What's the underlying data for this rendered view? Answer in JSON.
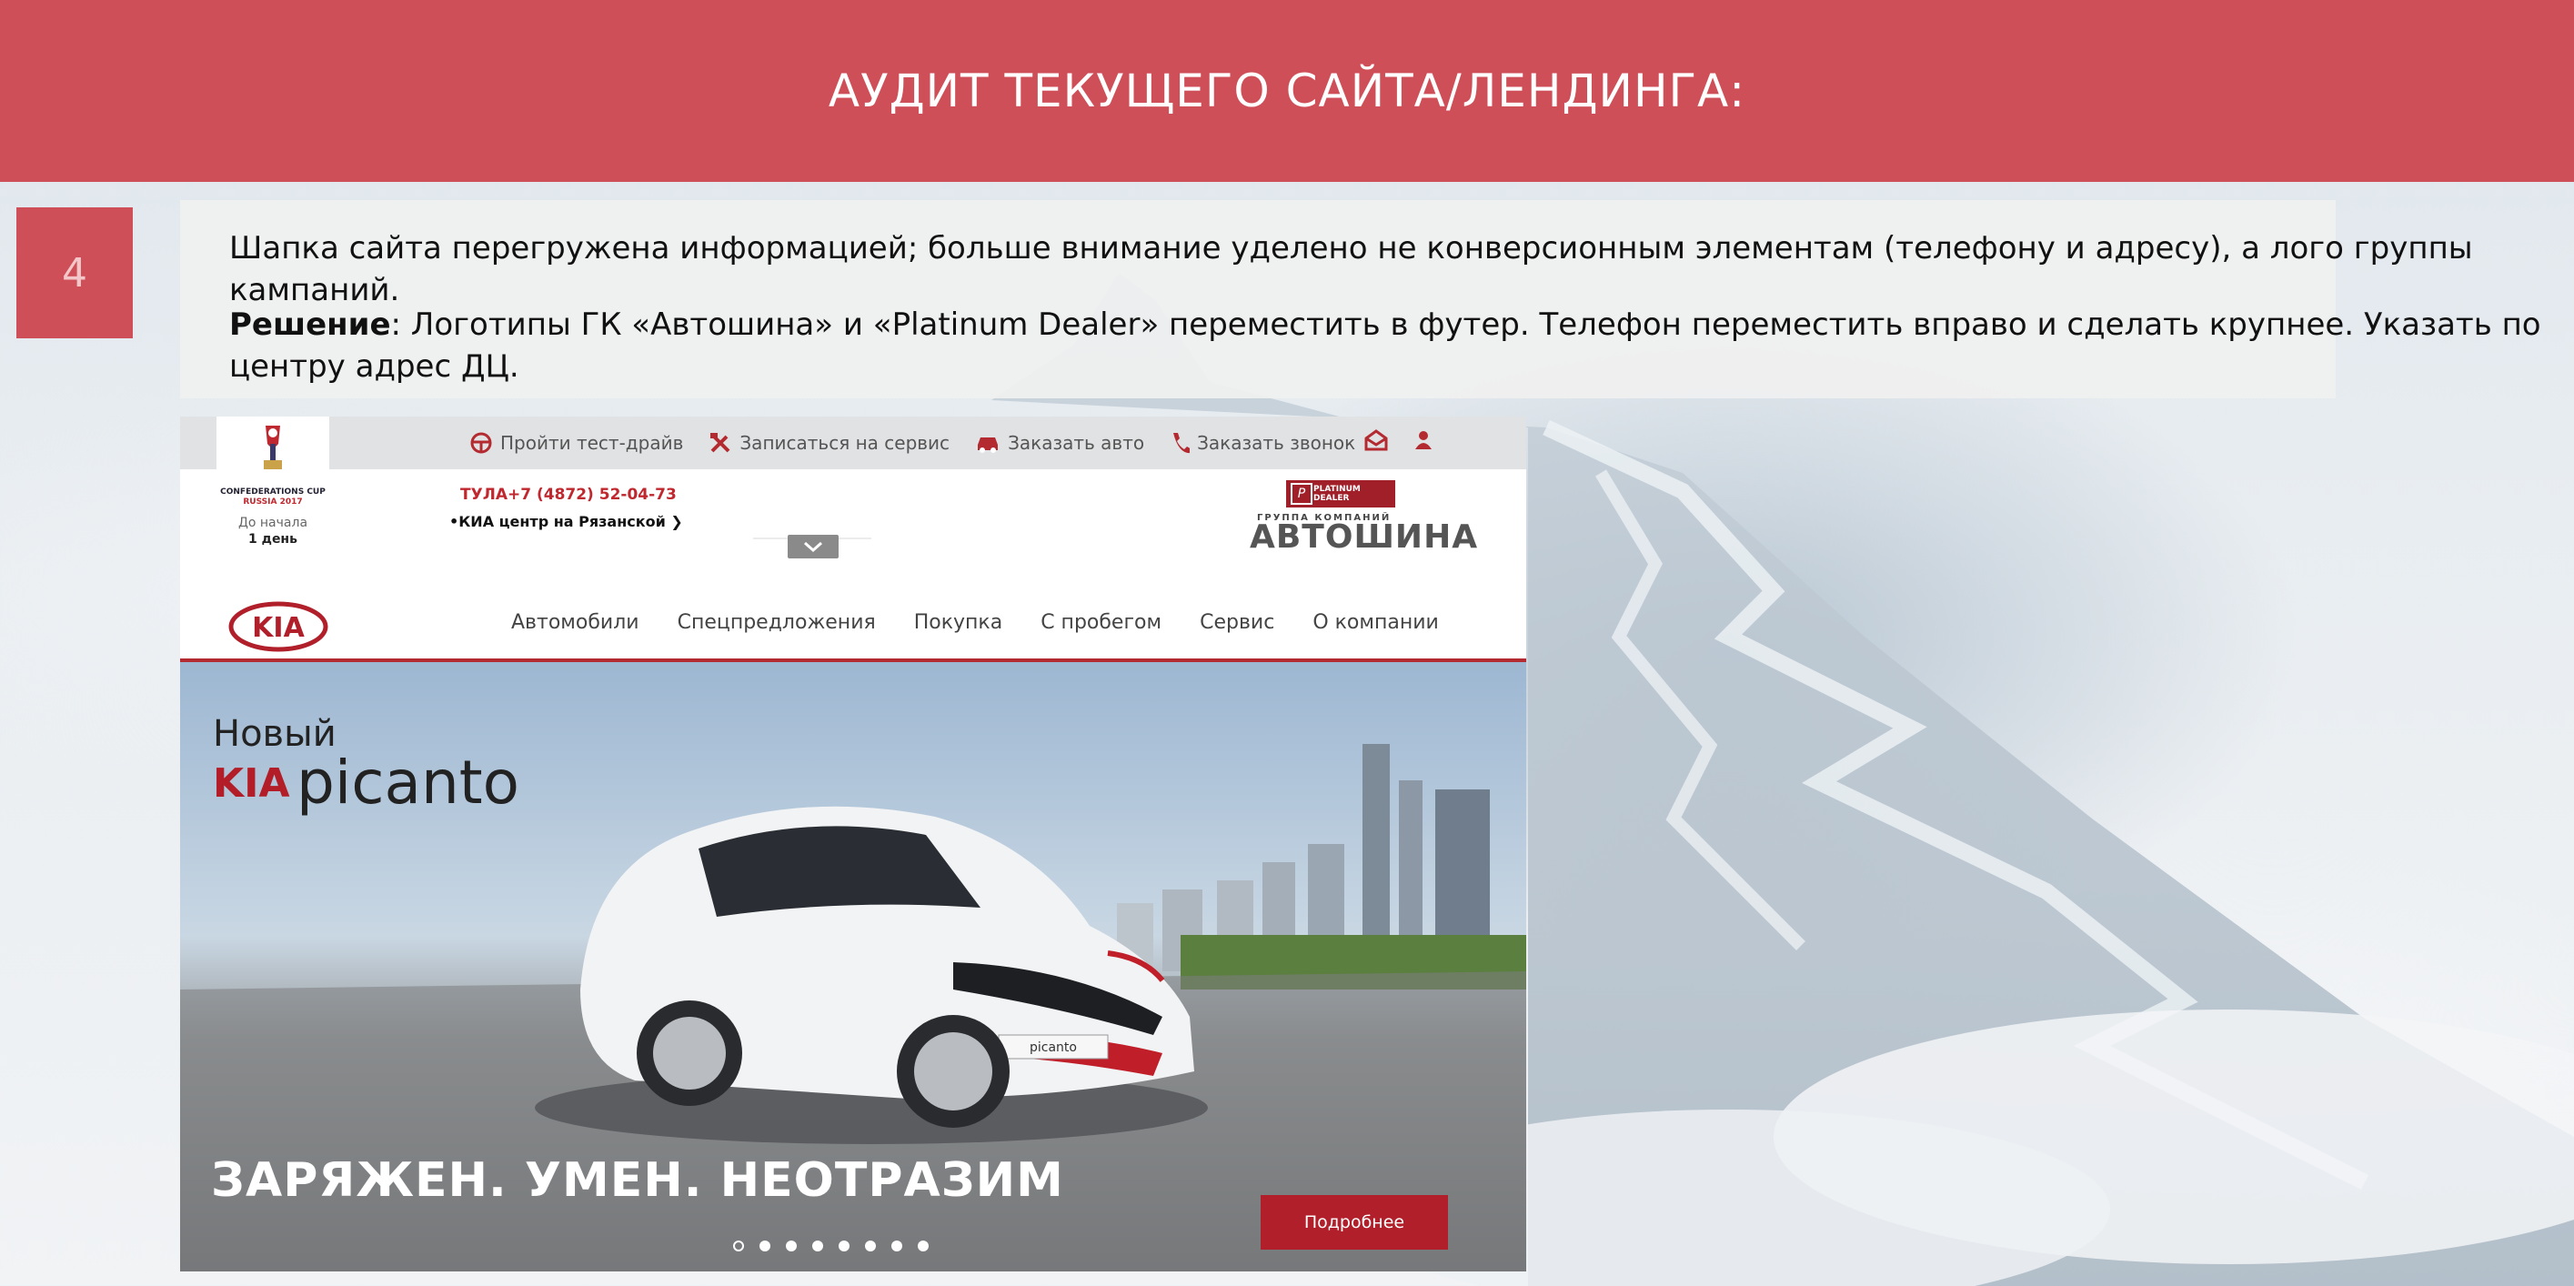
{
  "slide": {
    "title": "АУДИТ ТЕКУЩЕГО САЙТА/ЛЕНДИНГА:",
    "number": "4",
    "paragraph1": "Шапка сайта перегружена информацией; больше внимание уделено не конверсионным элементам (телефону и адресу), а лого группы кампаний.",
    "solution_label": "Решение",
    "solution_text": ": Логотипы ГК «Автошина» и «Platinum Dealer» переместить в футер. Телефон переместить вправо и сделать крупнее. Указать по центру адрес ДЦ."
  },
  "site": {
    "cup": {
      "line1": "CONFEDERATIONS CUP",
      "line2": "RUSSIA 2017",
      "days_label": "До начала",
      "days_value": "1 день"
    },
    "utility": [
      {
        "label": "Пройти тест-драйв",
        "icon": "steering-wheel-icon"
      },
      {
        "label": "Записаться на сервис",
        "icon": "tools-icon"
      },
      {
        "label": "Заказать авто",
        "icon": "car-icon"
      },
      {
        "label": "Заказать звонок",
        "icon": "phone-icon"
      }
    ],
    "phone": "ТУЛА+7 (4872) 52-04-73",
    "dealer": "•КИА центр на Рязанской ❯",
    "platinum": "PLATINUM DEALER",
    "group_sub": "ГРУППА КОМПАНИЙ",
    "group_name": "АВТОШИНА",
    "nav": [
      "Автомобили",
      "Спецпредложения",
      "Покупка",
      "С пробегом",
      "Сервис",
      "О компании"
    ],
    "hero": {
      "new": "Новый",
      "brand": "KIA",
      "model": "picanto",
      "slogan": "ЗАРЯЖЕН. УМЕН. НЕОТРАЗИМ",
      "button": "Подробнее",
      "plate": "picanto"
    },
    "colors": {
      "accent": "#cf4f58",
      "kia_red": "#b01f2a"
    }
  }
}
